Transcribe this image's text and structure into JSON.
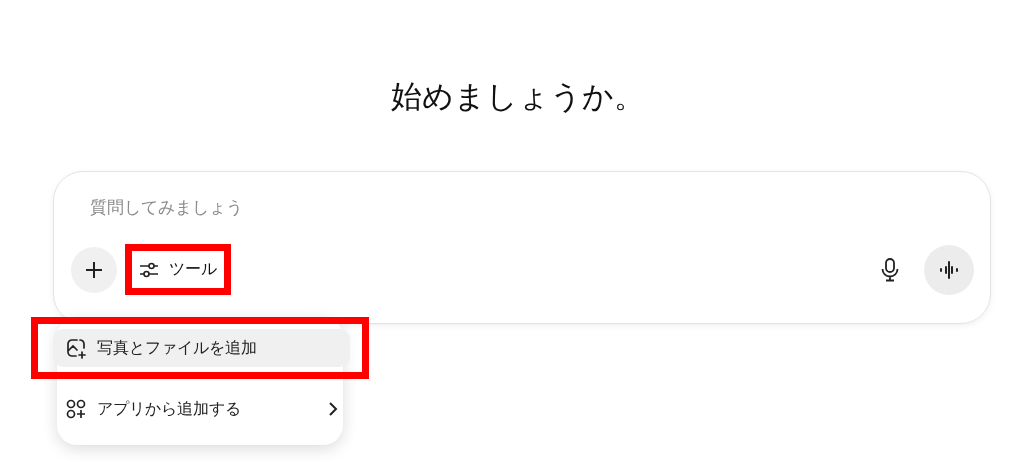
{
  "heading": "始めましょうか。",
  "composer": {
    "placeholder": "質問してみましょう",
    "tools_button": {
      "label": "ツール",
      "highlighted": true
    }
  },
  "menu": {
    "items": [
      {
        "kind": "photo",
        "label": "写真とファイルを追加",
        "selected": true,
        "highlighted": true,
        "submenu": false
      },
      {
        "kind": "apps",
        "label": "アプリから追加する",
        "selected": false,
        "highlighted": false,
        "submenu": true
      }
    ]
  }
}
